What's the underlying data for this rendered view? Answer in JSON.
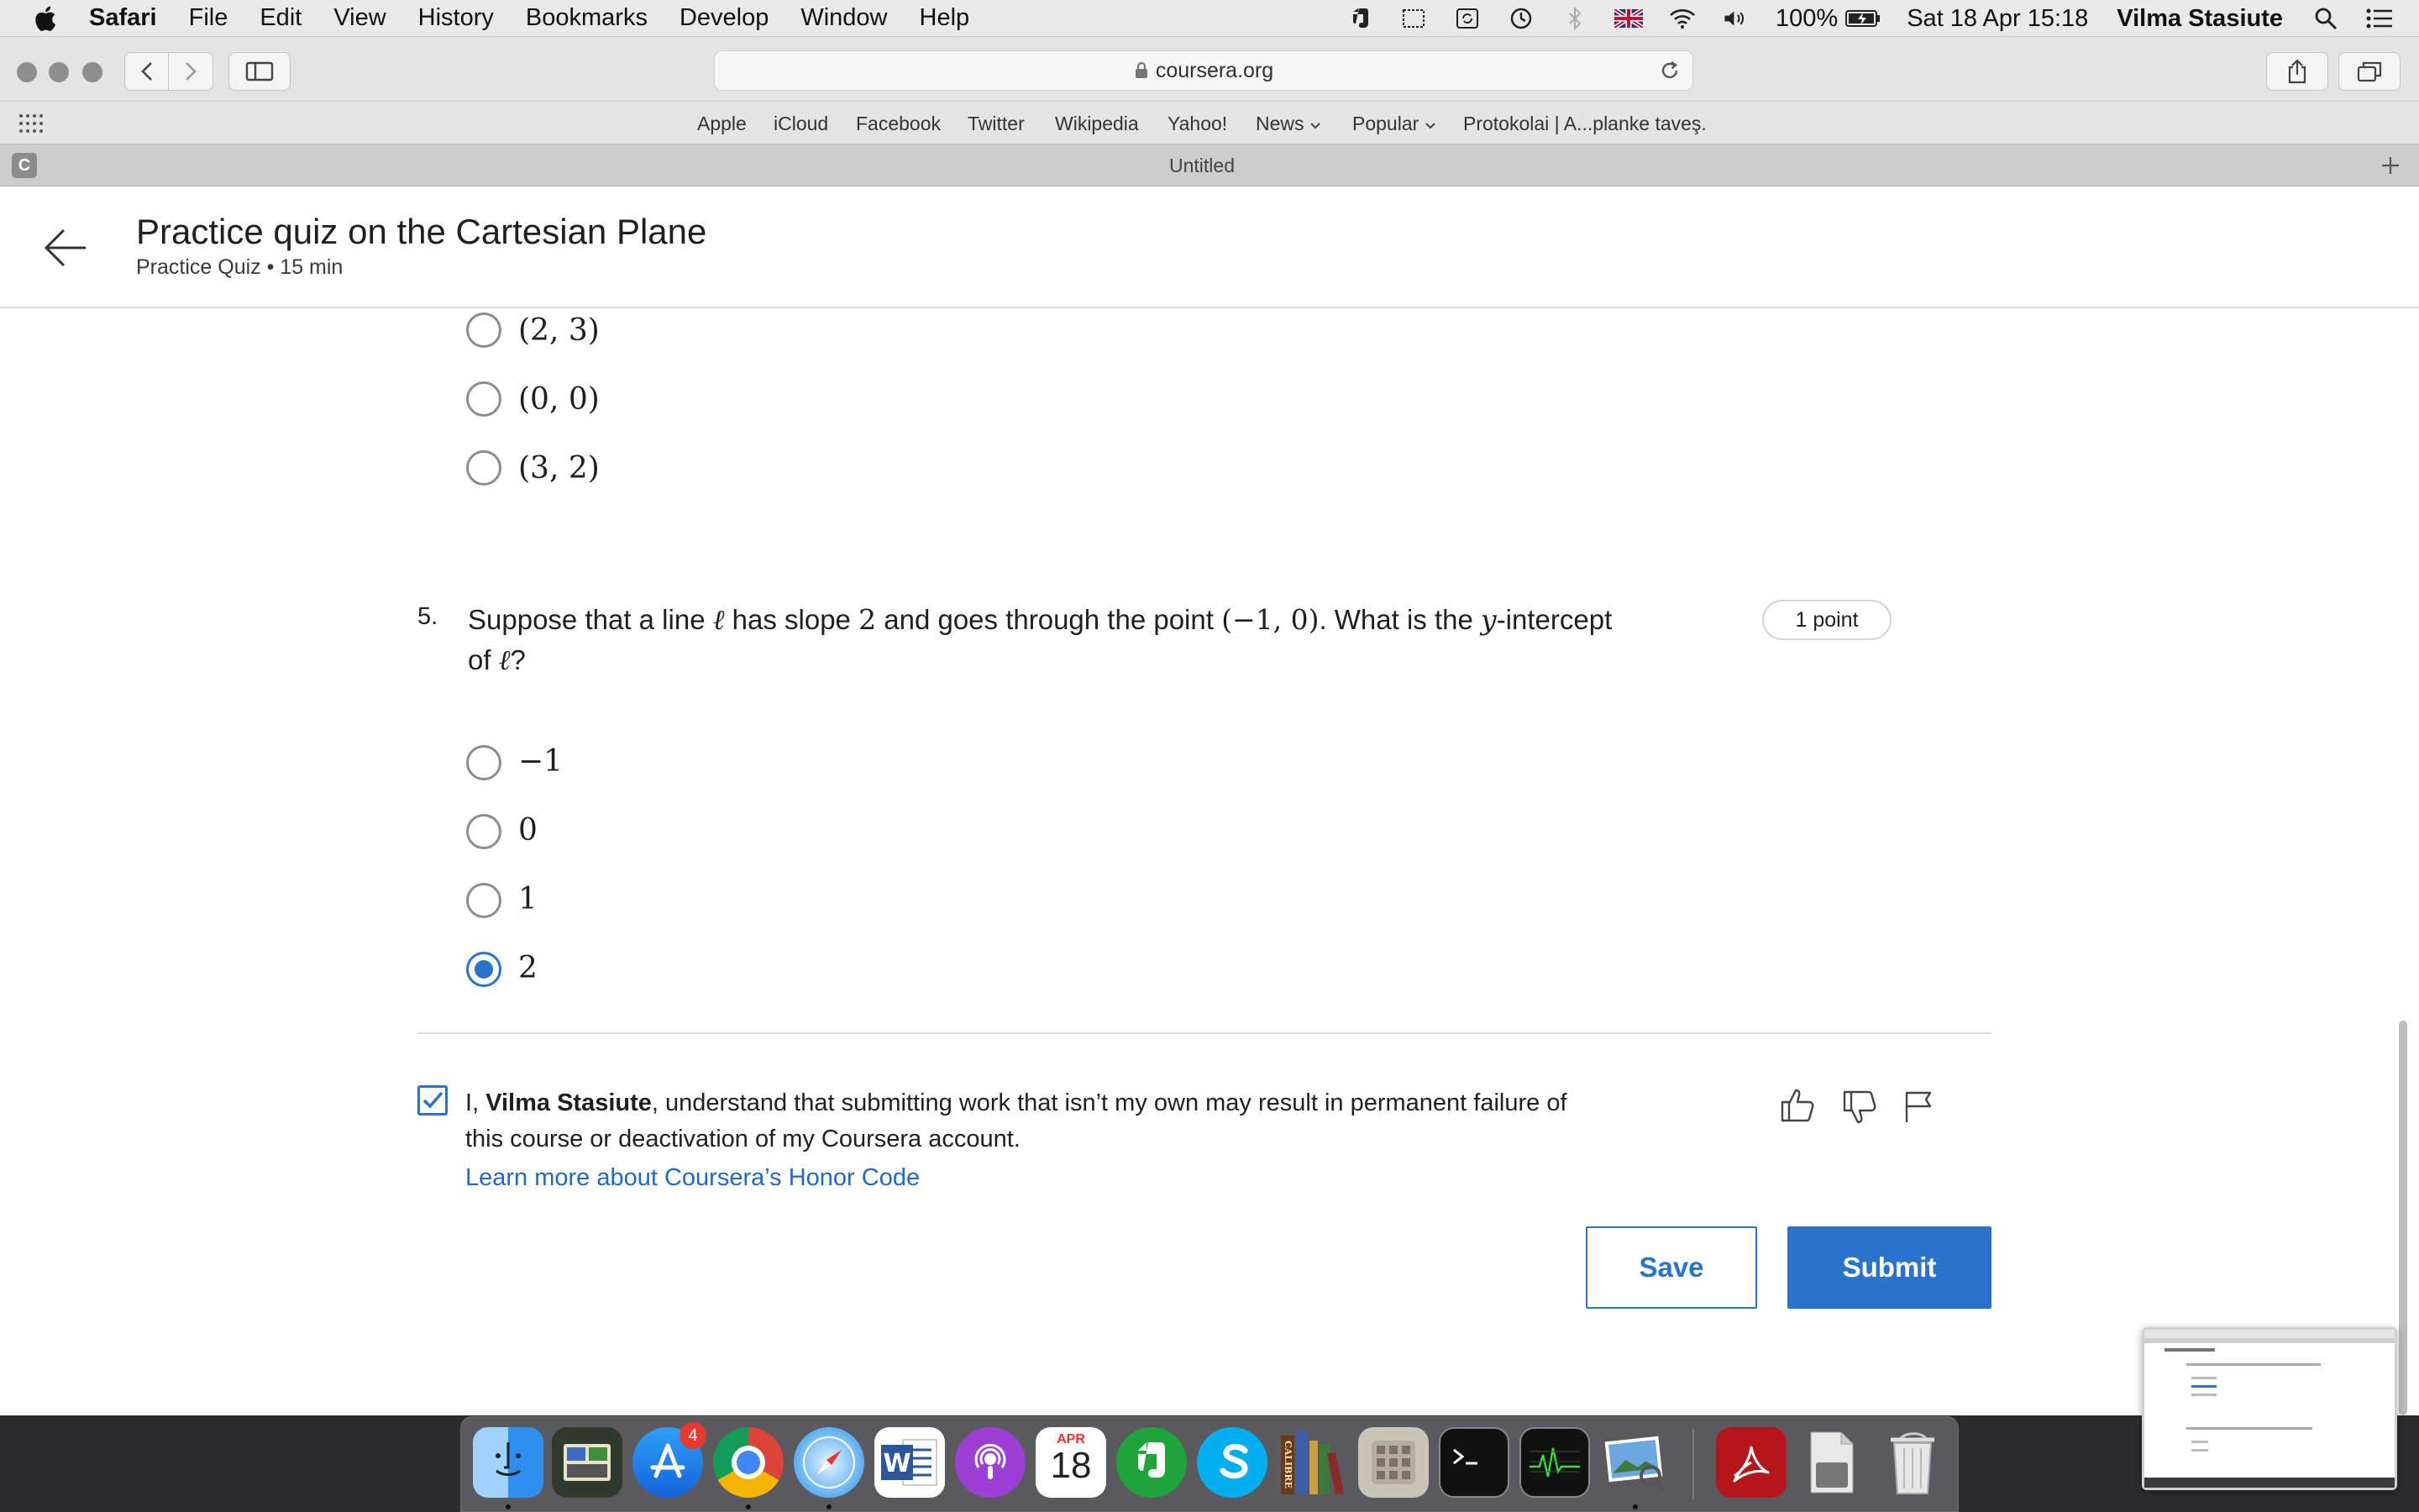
{
  "menubar": {
    "app": "Safari",
    "items": [
      "File",
      "Edit",
      "View",
      "History",
      "Bookmarks",
      "Develop",
      "Window",
      "Help"
    ],
    "battery": "100%",
    "datetime": "Sat 18 Apr  15:18",
    "user": "Vilma Stasiute"
  },
  "browser": {
    "url": "coursera.org",
    "favorites": [
      "Apple",
      "iCloud",
      "Facebook",
      "Twitter",
      "Wikipedia",
      "Yahoo!",
      "News",
      "Popular",
      "Protokolai | A...planke taveş."
    ],
    "tab_title": "Untitled",
    "tab_favicon_letter": "C"
  },
  "header": {
    "title": "Practice quiz on the Cartesian Plane",
    "subtitle": "Practice Quiz • 15 min"
  },
  "question4": {
    "options": [
      "(2, 3)",
      "(0, 0)",
      "(3, 2)"
    ],
    "selected": null
  },
  "question5": {
    "number": "5.",
    "text_1": "Suppose that a line ",
    "ell": "ℓ",
    "text_2": " has slope ",
    "slope": "2",
    "text_3": " and goes through the point ",
    "point": "(−1, 0)",
    "text_4": ". What is the ",
    "y_var": "y",
    "text_5": "-intercept",
    "text_6": "of ",
    "text_7": "?",
    "points": "1 point",
    "options": [
      "−1",
      "0",
      "1",
      "2"
    ],
    "selected_index": 3
  },
  "honor": {
    "checked": true,
    "prefix": "I, ",
    "name": "Vilma Stasiute",
    "suffix": ", understand that submitting work that isn’t my own may result in permanent failure of this course or deactivation of my Coursera account.",
    "link": "Learn more about Coursera’s Honor Code"
  },
  "actions": {
    "save": "Save",
    "submit": "Submit"
  },
  "dock": {
    "calendar_month": "APR",
    "calendar_day": "18",
    "appstore_badge": "4",
    "calibre_label": "CALIBRE"
  },
  "colors": {
    "accent": "#2a73cc",
    "link": "#1f6ac2"
  }
}
